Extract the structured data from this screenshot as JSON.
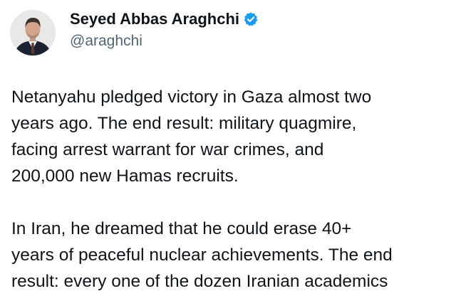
{
  "author": {
    "display_name": "Seyed Abbas Araghchi",
    "handle": "@araghchi",
    "verified": true,
    "verified_badge_icon": "verified-badge-icon",
    "avatar_icon": "avatar-portrait"
  },
  "tweet": {
    "paragraphs": [
      "Netanyahu pledged victory in Gaza almost two\nyears ago. The end result: military quagmire,\nfacing arrest warrant for war crimes, and\n200,000 new Hamas recruits.",
      "In Iran, he dreamed that he could erase 40+\nyears of peaceful nuclear achievements. The end\nresult: every one of the dozen Iranian academics"
    ]
  },
  "colors": {
    "text_primary": "#0f1419",
    "text_secondary": "#536471",
    "verified_blue": "#1d9bf0",
    "background": "#ffffff"
  }
}
